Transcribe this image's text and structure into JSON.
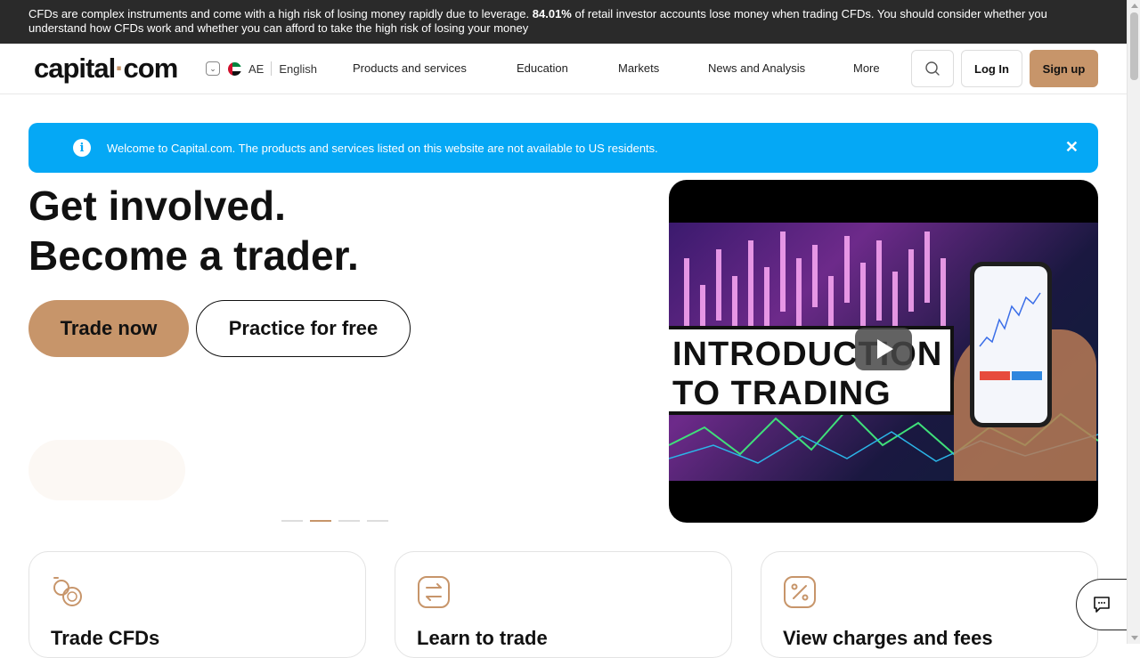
{
  "risk_warning": {
    "part1": "CFDs are complex instruments and come with a high risk of losing money rapidly due to leverage. ",
    "percent": "84.01%",
    "part2": " of retail investor accounts lose money when trading CFDs. You should consider whether you understand how CFDs work and whether you can afford to take the high risk of losing your money"
  },
  "header": {
    "logo_main": "capital",
    "logo_dot": "·",
    "logo_tld": "com",
    "region_code": "AE",
    "language": "English",
    "nav": [
      "Products and services",
      "Education",
      "Markets",
      "News and Analysis",
      "More"
    ],
    "login": "Log In",
    "signup": "Sign up"
  },
  "notice": {
    "icon": "i",
    "text": "Welcome to Capital.com. The products and services listed on this website are not available to US residents.",
    "close": "✕"
  },
  "hero": {
    "title_line1": "Get involved.",
    "title_line2": "Become a trader.",
    "trade_button": "Trade now",
    "practice_button": "Practice for free",
    "slides_count": 4,
    "active_slide": 2
  },
  "video": {
    "title_line1": "INTRODUCTION",
    "title_line2": "TO TRADING"
  },
  "cards": [
    {
      "title": "Trade CFDs",
      "icon": "coins-icon"
    },
    {
      "title": "Learn to trade",
      "icon": "exchange-icon"
    },
    {
      "title": "View charges and fees",
      "icon": "percent-icon"
    }
  ],
  "colors": {
    "accent": "#c7956a",
    "notice_bg": "#05a8f5",
    "risk_bar_bg": "#2a2a2a"
  }
}
